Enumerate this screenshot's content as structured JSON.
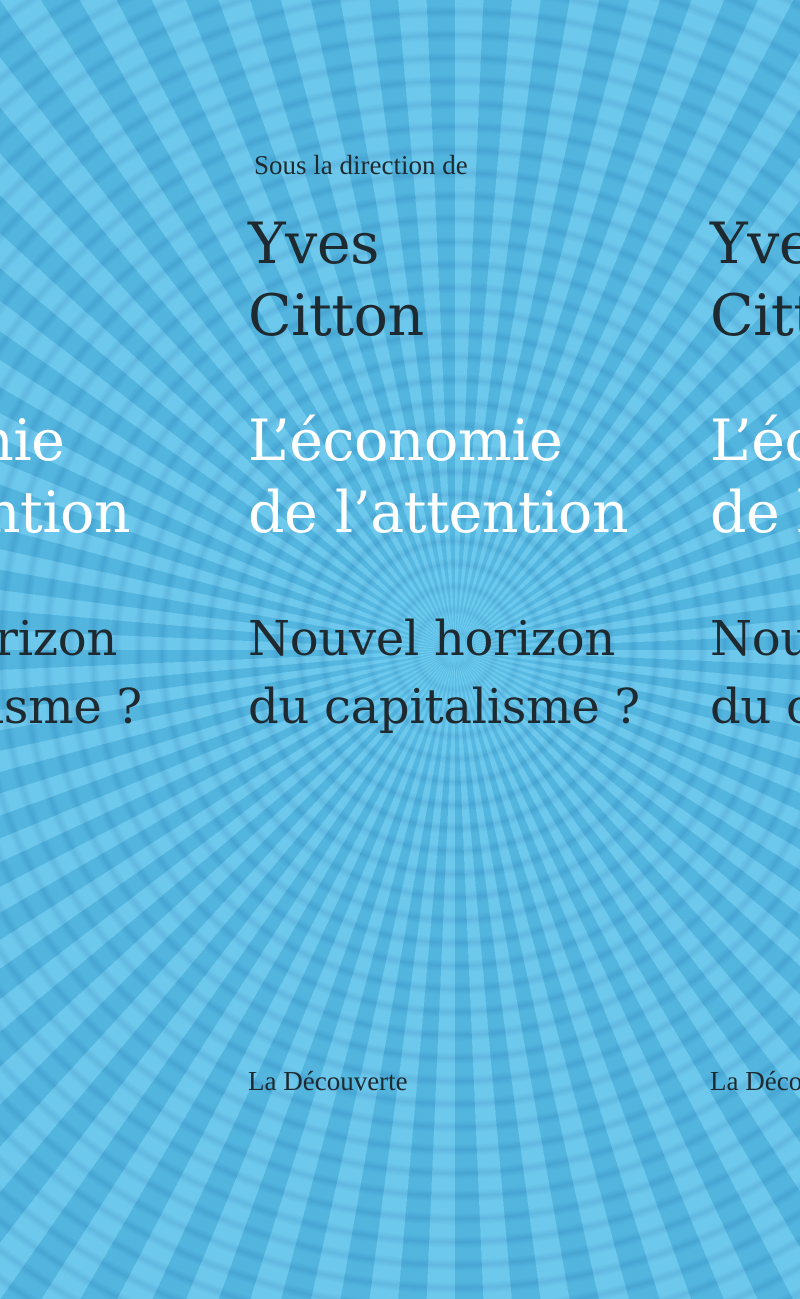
{
  "cover": {
    "direction_label": "Sous la direction de",
    "author": {
      "first_name": "Yves",
      "last_name": "Citton"
    },
    "title": {
      "line1": "L’économie",
      "line2": "de l’attention"
    },
    "subtitle": {
      "line1": "Nouvel horizon",
      "line2": "du capitalisme ?"
    },
    "publisher": "La Découverte"
  },
  "colors": {
    "background": "#5bbde6",
    "dark_text": "#1f2a30",
    "title_text": "#ffffff"
  }
}
